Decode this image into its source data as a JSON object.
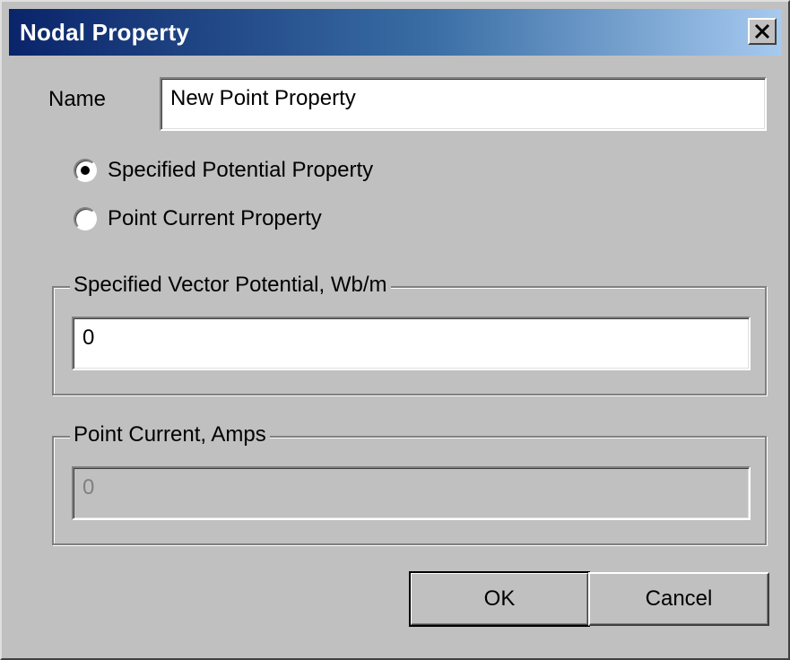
{
  "window": {
    "title": "Nodal Property",
    "close_icon": "close-icon"
  },
  "name_field": {
    "label": "Name",
    "value": "New Point Property"
  },
  "property_type": {
    "options": [
      {
        "label": "Specified Potential Property",
        "selected": true
      },
      {
        "label": "Point Current Property",
        "selected": false
      }
    ]
  },
  "vector_potential": {
    "legend": "Specified Vector Potential, Wb/m",
    "value": "0"
  },
  "point_current": {
    "legend": "Point Current, Amps",
    "value": "0",
    "disabled": true
  },
  "buttons": {
    "ok": "OK",
    "cancel": "Cancel"
  }
}
